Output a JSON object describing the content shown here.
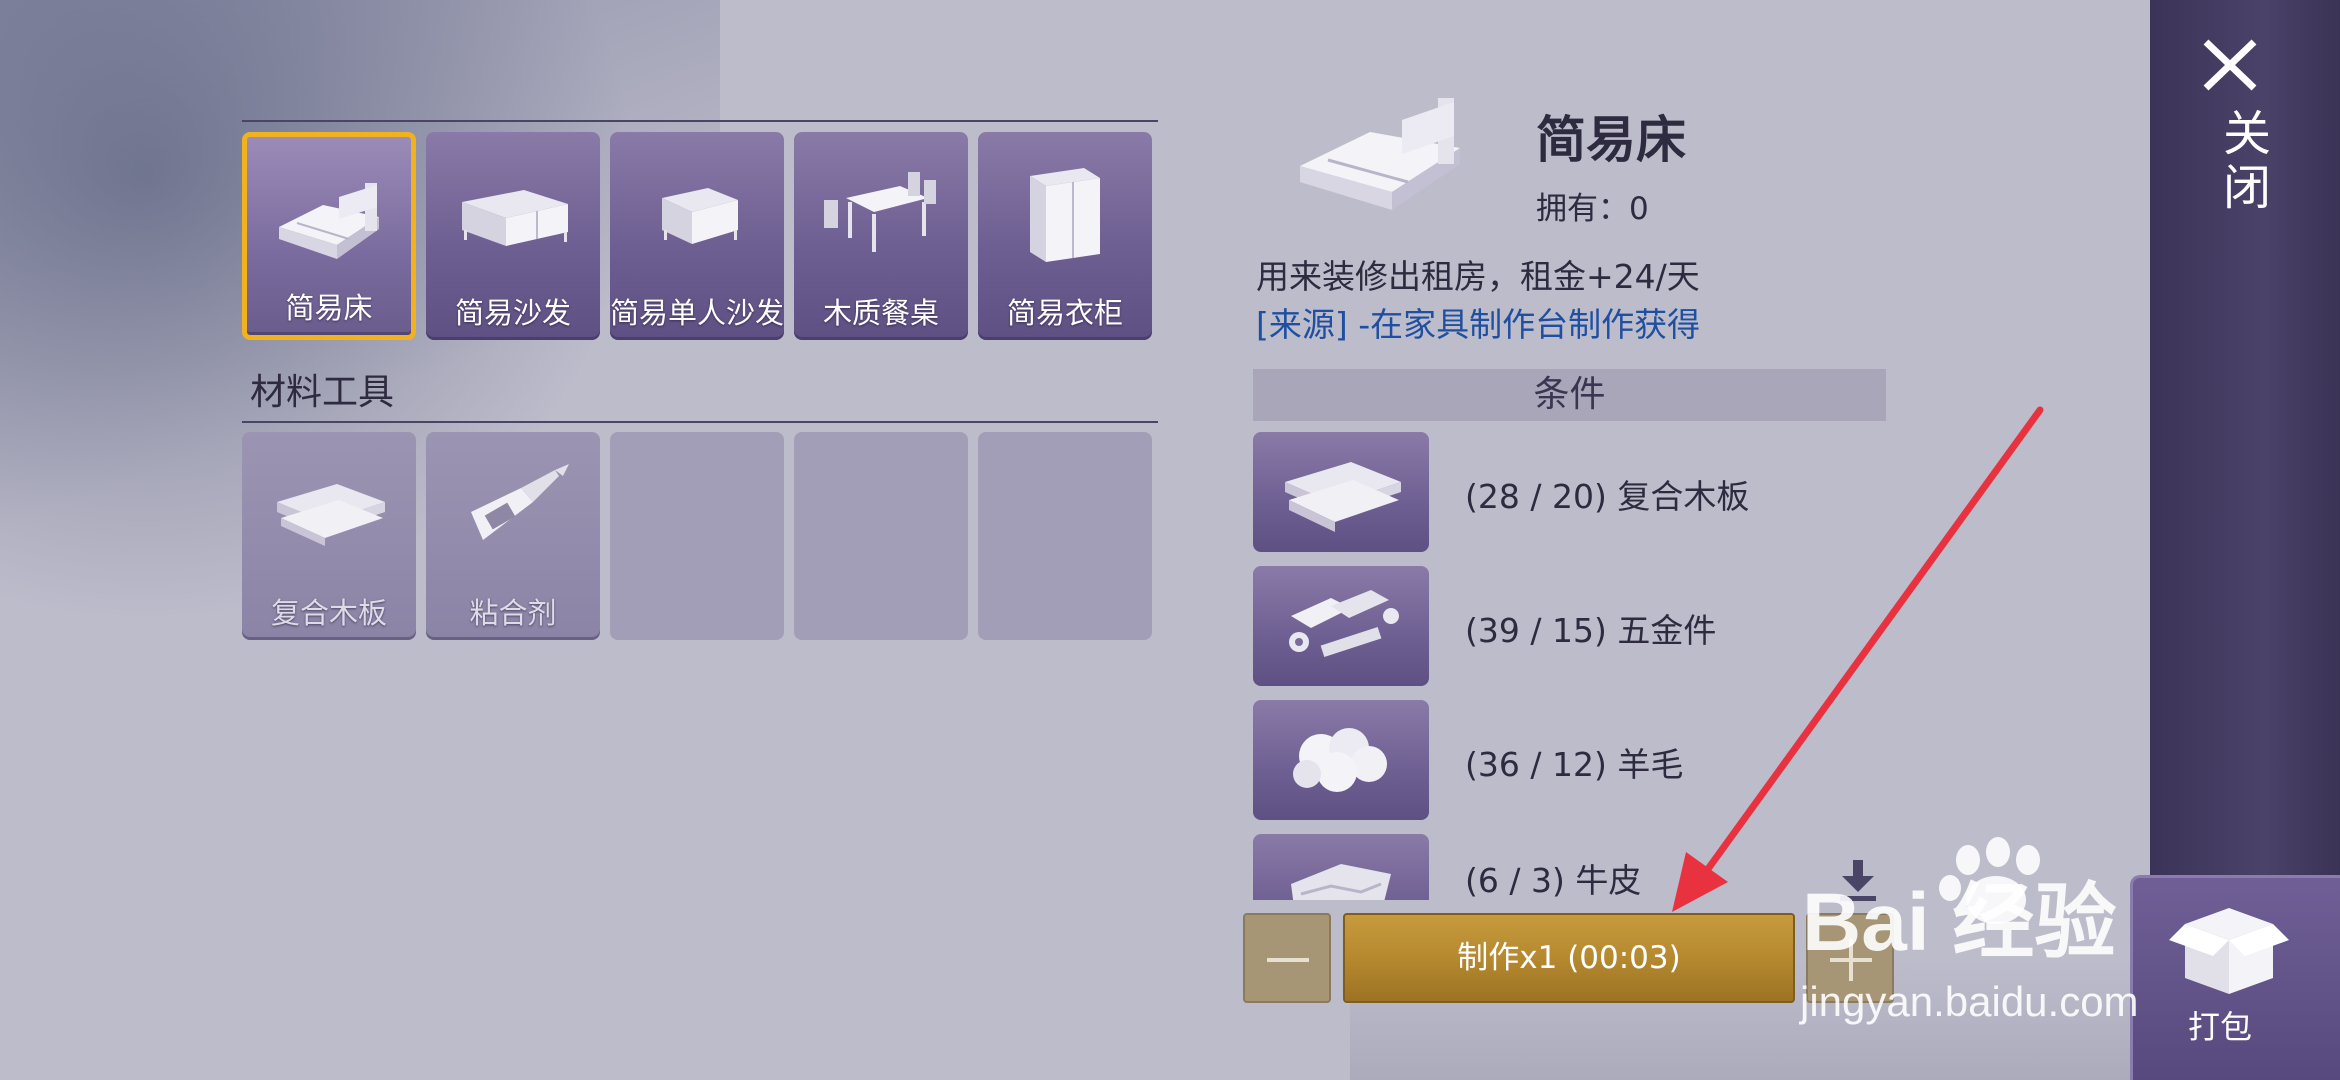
{
  "furniture": {
    "items": [
      {
        "label": "简易床",
        "icon": "bed-icon",
        "selected": true
      },
      {
        "label": "简易沙发",
        "icon": "sofa-icon",
        "selected": false
      },
      {
        "label": "简易单人沙发",
        "icon": "armchair-icon",
        "selected": false
      },
      {
        "label": "木质餐桌",
        "icon": "dining-table-icon",
        "selected": false
      },
      {
        "label": "简易衣柜",
        "icon": "wardrobe-icon",
        "selected": false
      }
    ]
  },
  "materials": {
    "title": "材料工具",
    "items": [
      {
        "label": "复合木板",
        "icon": "plank-icon"
      },
      {
        "label": "粘合剂",
        "icon": "glue-icon"
      }
    ]
  },
  "detail": {
    "name": "简易床",
    "owned": "拥有：0",
    "description": "用来装修出租房，租金+24/天",
    "source": "[来源] -在家具制作台制作获得",
    "conditions_title": "条件",
    "requirements": [
      {
        "text": "(28 / 20) 复合木板",
        "icon": "plank-icon"
      },
      {
        "text": "(39 / 15) 五金件",
        "icon": "hardware-icon"
      },
      {
        "text": "(36 / 12) 羊毛",
        "icon": "wool-icon"
      },
      {
        "text": "(6 / 3) 牛皮",
        "icon": "leather-icon"
      }
    ]
  },
  "actions": {
    "craft_label": "制作x1 (00:03)",
    "close_label": "关闭",
    "pack_label": "打包"
  },
  "watermark": {
    "text": "Bai 经验",
    "url": "jingyan.baidu.com"
  },
  "colors": {
    "accent_gold": "#f0b31f",
    "craft_button": "#b6892f",
    "slot_purple": "#6e5f92",
    "annotation_arrow": "#e8323f"
  }
}
